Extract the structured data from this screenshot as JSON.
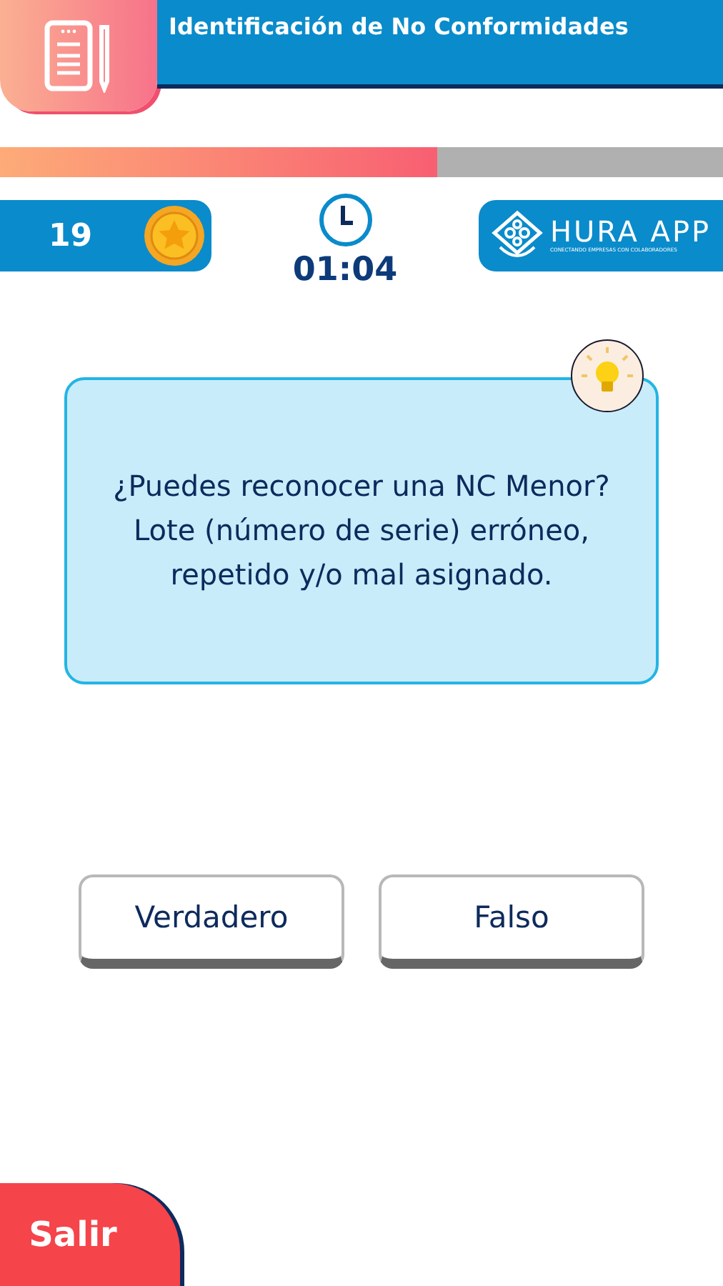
{
  "header": {
    "title": "Identificación de No Conformidades"
  },
  "progress": {
    "level": 0.605
  },
  "score": {
    "points": "19"
  },
  "timer": {
    "time": "01:04"
  },
  "logo": {
    "name": "HURA APP",
    "tagline": "CONECTANDO EMPRESAS CON COLABORADORES"
  },
  "question": {
    "text": "¿Puedes reconocer una NC Menor? Lote (número de serie) erróneo, repetido y/o mal asignado."
  },
  "answers": [
    {
      "label": "Verdadero"
    },
    {
      "label": "Falso"
    }
  ],
  "exit_button": {
    "label": "Salir"
  }
}
